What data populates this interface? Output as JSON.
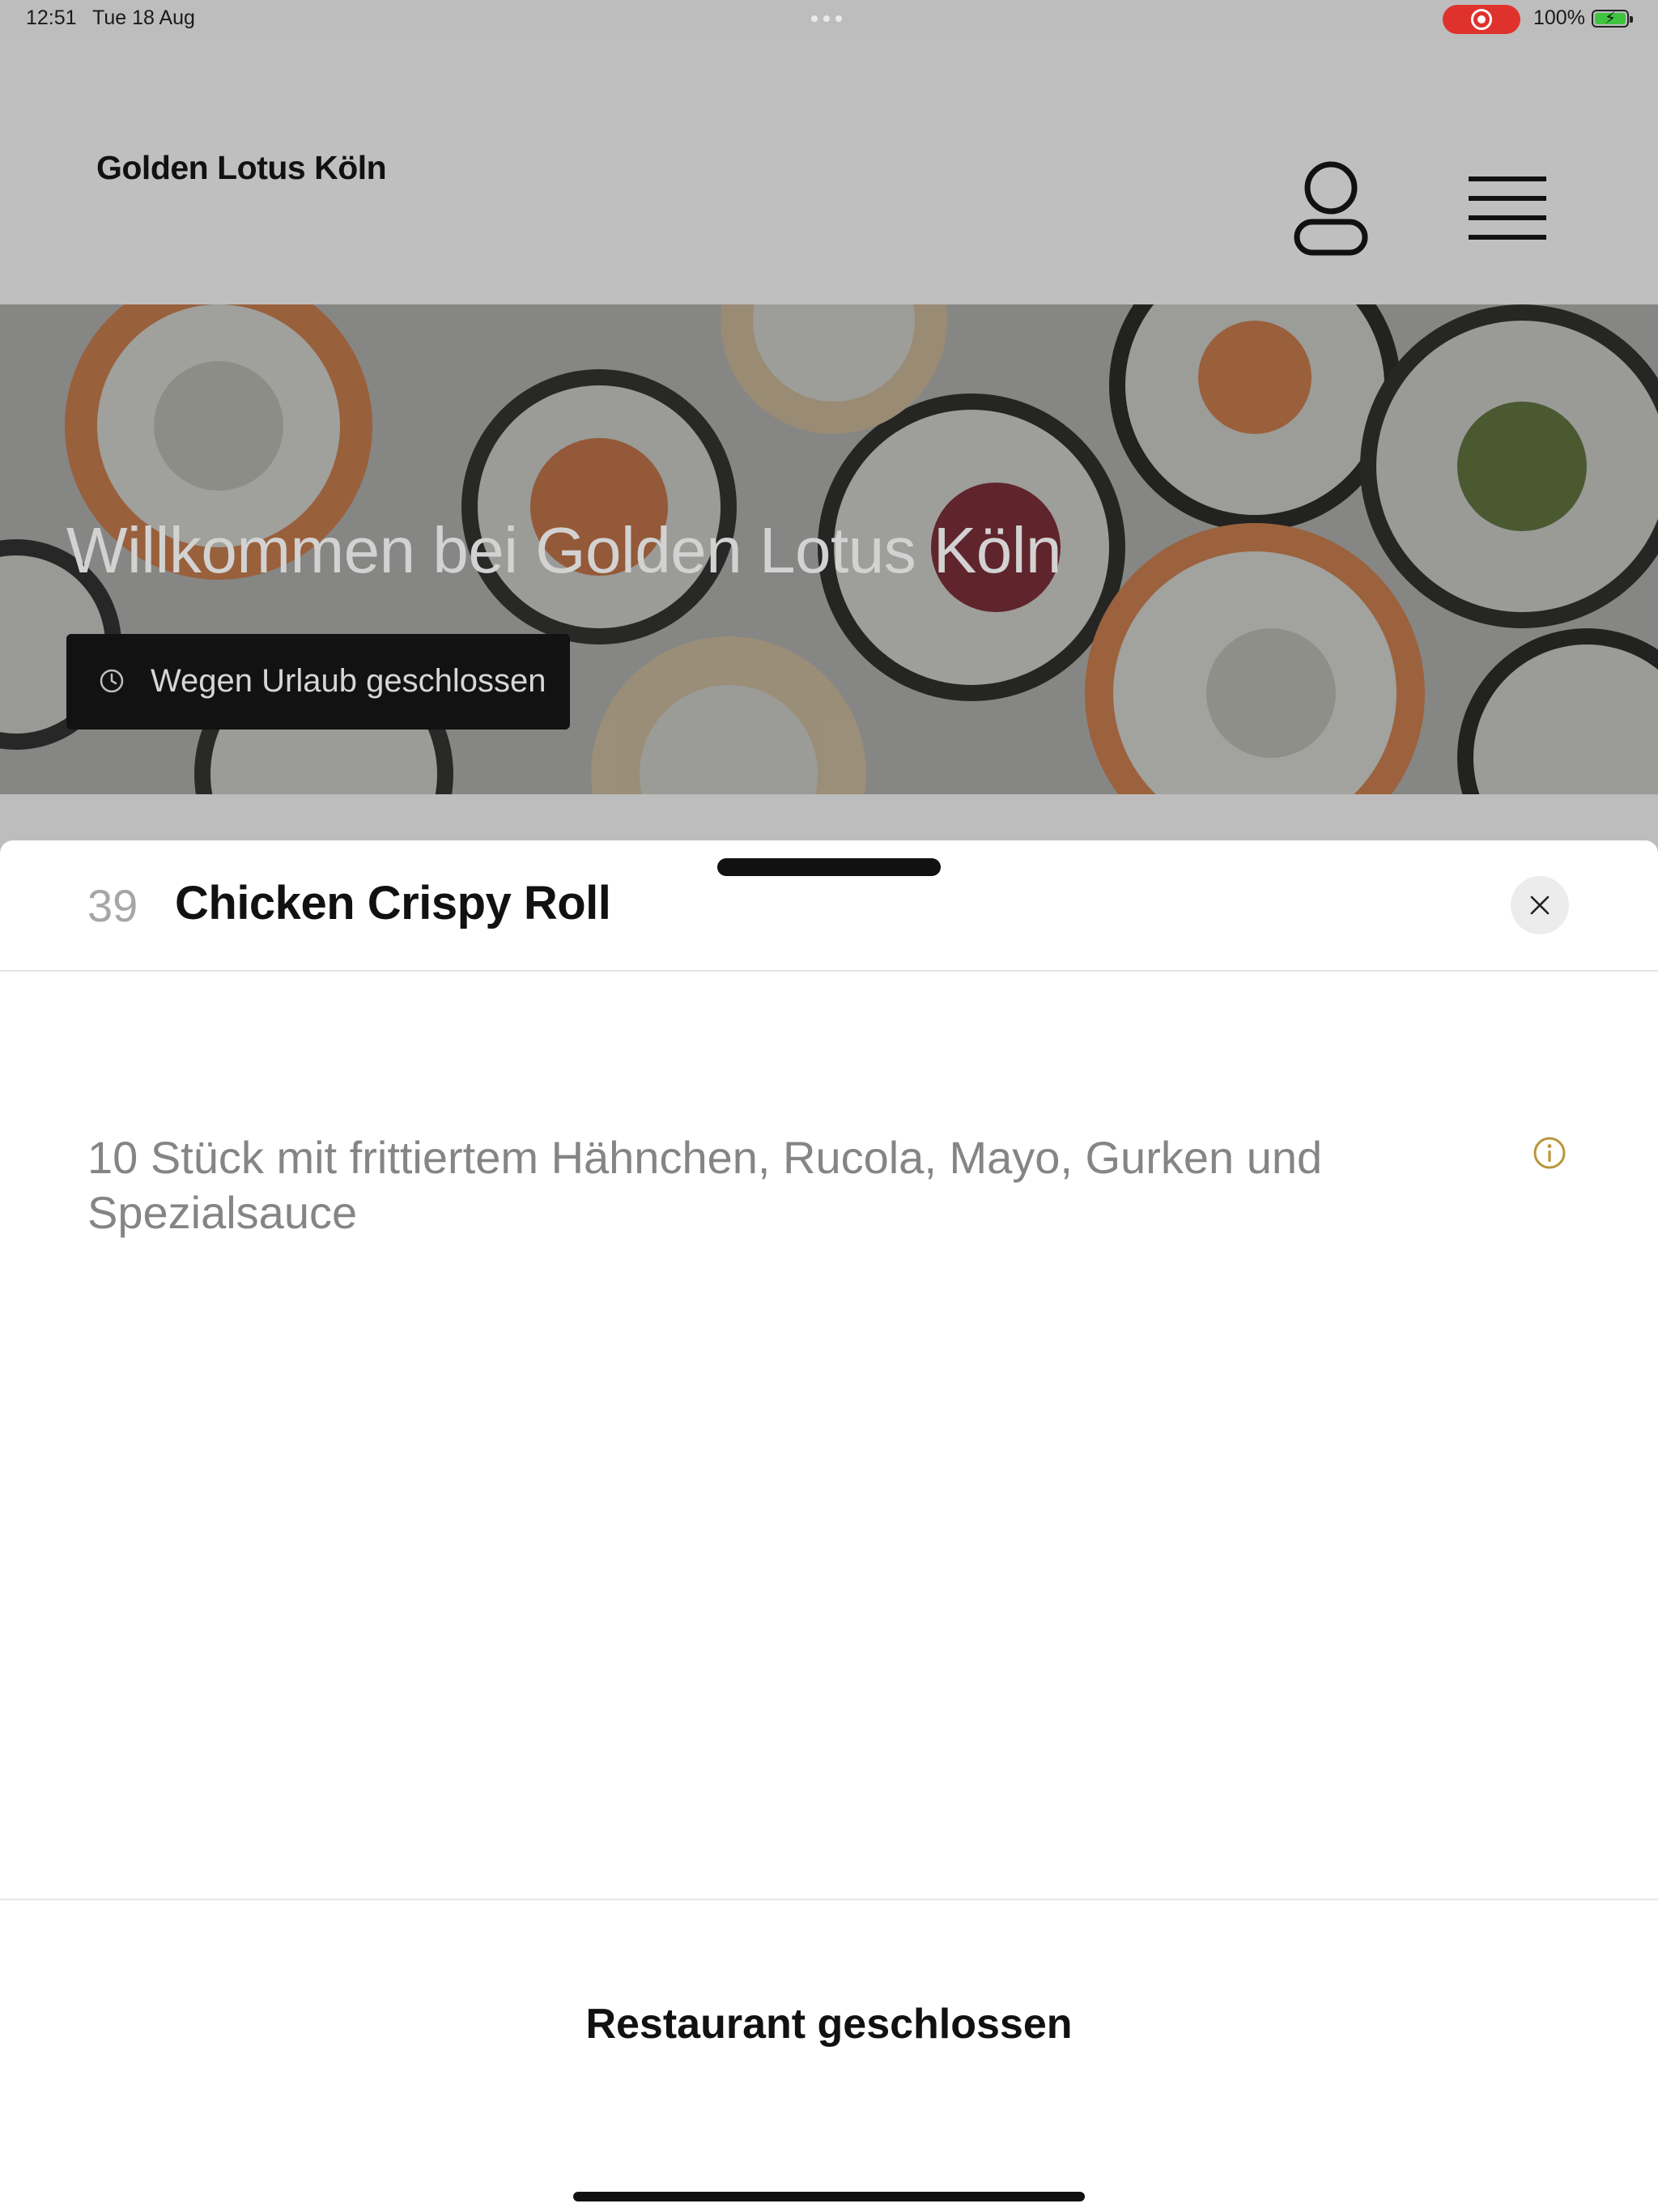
{
  "status_bar": {
    "time": "12:51",
    "date": "Tue 18 Aug",
    "battery_percent": "100%",
    "battery_level": 1.0,
    "recording_color": "#e0322d",
    "battery_color": "#3ec43e"
  },
  "header": {
    "brand": "Golden Lotus Köln",
    "account_icon": "user-icon",
    "menu_icon": "hamburger-menu-icon"
  },
  "hero": {
    "title": "Willkommen bei Golden Lotus Köln",
    "badge_label": "Wegen Urlaub geschlossen",
    "badge_icon": "clock-icon",
    "image": "sushi-rolls-photo"
  },
  "item_sheet": {
    "number": "39",
    "name": "Chicken Crispy Roll",
    "description": "10 Stück mit frittiertem Hähnchen, Rucola, Mayo, Gurken und Spezialsauce",
    "info_icon": "info-icon",
    "info_icon_color": "#b8963a",
    "close_icon": "close-icon",
    "footer_status": "Restaurant geschlossen"
  }
}
